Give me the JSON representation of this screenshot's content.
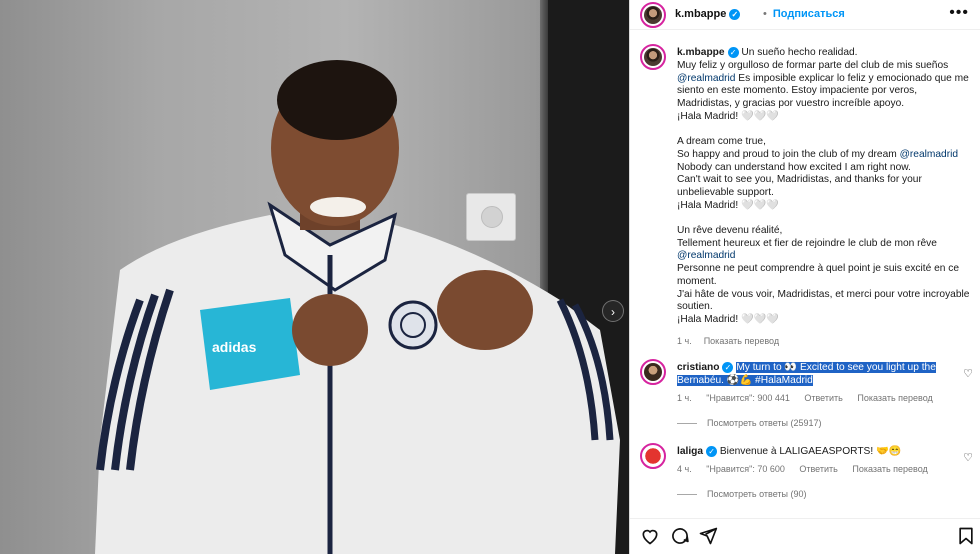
{
  "post": {
    "username": "k.mbappe",
    "follow_label": "Подписаться",
    "more_label": "•••",
    "next_label": "›"
  },
  "caption": {
    "username": "k.mbappe",
    "p1_first": "Un sueño hecho realidad.",
    "p1_a": "Muy feliz y orgulloso de formar parte del club de mis sueños",
    "p1_mention": "@realmadrid",
    "p1_b": " Es imposible explicar lo feliz y emocionado que me siento en este momento. Estoy impaciente por veros, Madridistas, y gracias por vuestro increíble apoyo.",
    "p1_end": "¡Hala Madrid! 🤍🤍🤍",
    "p2_a": "A dream come true,",
    "p2_b": "So happy and proud to join the club of my dream ",
    "p2_mention": "@realmadrid",
    "p2_c": "Nobody can understand how excited I am right now.",
    "p2_d": "Can't wait to see you, Madridistas, and thanks for your unbelievable support.",
    "p2_end": "¡Hala Madrid! 🤍🤍🤍",
    "p3_a": "Un rêve devenu réalité,",
    "p3_b": "Tellement heureux et fier de rejoindre le club de mon rêve",
    "p3_mention": "@realmadrid",
    "p3_c": "Personne ne peut comprendre à quel point je suis excité en ce moment.",
    "p3_d": "J'ai hâte de vous voir, Madridistas, et merci pour votre incroyable soutien.",
    "p3_end": "¡Hala Madrid! 🤍🤍🤍",
    "time": "1 ч.",
    "translate": "Показать перевод"
  },
  "comments": [
    {
      "username": "cristiano",
      "text": "My turn to 👀 Excited to see you light up the Bernabéu. ⚽💪 #HalaMadrid",
      "time": "1 ч.",
      "likes": "\"Нравится\": 900 441",
      "reply": "Ответить",
      "translate": "Показать перевод",
      "view_replies": "Посмотреть ответы (25917)"
    },
    {
      "username": "laliga",
      "text": "Bienvenue à LALIGAEASPORTS! 🤝😁",
      "time": "4 ч.",
      "likes": "\"Нравится\": 70 600",
      "reply": "Ответить",
      "translate": "Показать перевод",
      "view_replies": "Посмотреть ответы (90)"
    }
  ],
  "icons": [
    "heart-icon",
    "comment-icon",
    "share-icon",
    "bookmark-icon",
    "verified-badge-icon",
    "chevron-right-icon"
  ],
  "colors": {
    "accent": "#0095f6",
    "highlight": "#1f63c5",
    "link": "#00376b"
  }
}
